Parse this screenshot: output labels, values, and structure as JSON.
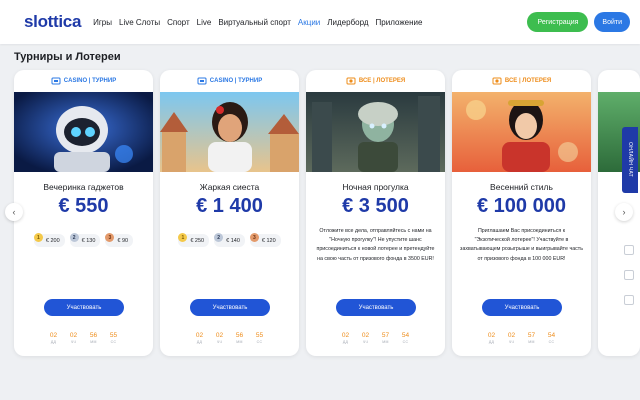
{
  "header": {
    "logo": "slottica",
    "nav": [
      "Игры",
      "Live Слоты",
      "Спорт",
      "Live",
      "Виртуальный спорт",
      "Акции",
      "Лидерборд",
      "Приложение"
    ],
    "active_nav": "Акции",
    "register_label": "Регистрация",
    "login_label": "Войти"
  },
  "section_title": "Турниры и Лотереи",
  "colors": {
    "brand": "#1f3aa8",
    "accent": "#2b78e4",
    "register": "#3dbd4f",
    "timer": "#ee8c1a",
    "lottery_tag": "#ee8c1a"
  },
  "cards": [
    {
      "tag": "CASINO | ТУРНИР",
      "tag_type": "casino",
      "title": "Вечеринка гаджетов",
      "amount": "€ 550",
      "prizes": [
        {
          "place": "1",
          "value": "€ 200"
        },
        {
          "place": "2",
          "value": "€ 130"
        },
        {
          "place": "3",
          "value": "€ 90"
        }
      ],
      "cta": "Участвовать",
      "timer": [
        {
          "v": "02",
          "l": "ДД"
        },
        {
          "v": "02",
          "l": "ЧЧ"
        },
        {
          "v": "56",
          "l": "ММ"
        },
        {
          "v": "55",
          "l": "СС"
        }
      ]
    },
    {
      "tag": "CASINO | ТУРНИР",
      "tag_type": "casino",
      "title": "Жаркая сиеста",
      "amount": "€ 1 400",
      "prizes": [
        {
          "place": "1",
          "value": "€ 250"
        },
        {
          "place": "2",
          "value": "€ 140"
        },
        {
          "place": "3",
          "value": "€ 120"
        }
      ],
      "cta": "Участвовать",
      "timer": [
        {
          "v": "02",
          "l": "ДД"
        },
        {
          "v": "02",
          "l": "ЧЧ"
        },
        {
          "v": "56",
          "l": "ММ"
        },
        {
          "v": "55",
          "l": "СС"
        }
      ]
    },
    {
      "tag": "ВСЕ | ЛОТЕРЕЯ",
      "tag_type": "lottery",
      "title": "Ночная прогулка",
      "amount": "€ 3 500",
      "description": "Отложите все дела, отправляйтесь с нами на \"Ночную прогулку\"! Не упустите шанс присоединиться к новой лотерее и претендуйте на свою часть от призового фонда в 3500 EUR!",
      "cta": "Участвовать",
      "timer": [
        {
          "v": "02",
          "l": "ДД"
        },
        {
          "v": "02",
          "l": "ЧЧ"
        },
        {
          "v": "57",
          "l": "ММ"
        },
        {
          "v": "54",
          "l": "СС"
        }
      ]
    },
    {
      "tag": "ВСЕ | ЛОТЕРЕЯ",
      "tag_type": "lottery",
      "title": "Весенний стиль",
      "amount": "€ 100 000",
      "description": "Приглашаем Вас присоединиться к \"Экзотической лотерее\"! Участвуйте в захватывающем розыгрыше и выигрывайте часть от призового фонда в 100 000 EUR!",
      "cta": "Участвовать",
      "timer": [
        {
          "v": "02",
          "l": "ДД"
        },
        {
          "v": "02",
          "l": "ЧЧ"
        },
        {
          "v": "57",
          "l": "ММ"
        },
        {
          "v": "54",
          "l": "СС"
        }
      ]
    }
  ],
  "slider": {
    "prev_icon": "chevron-left-icon",
    "next_icon": "chevron-right-icon"
  },
  "side_tab": "ОНЛАЙН ЧАТ"
}
